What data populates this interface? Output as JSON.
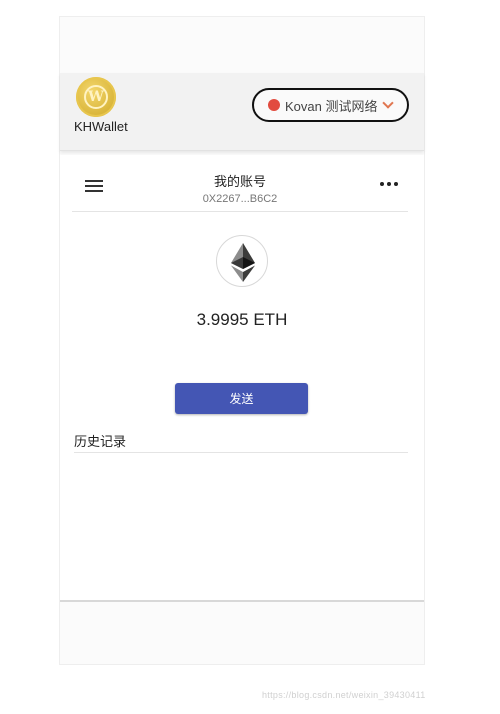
{
  "app": {
    "name": "KHWallet",
    "logo_icon": "wordpress-logo-icon"
  },
  "network": {
    "dot_color": "#e24c3f",
    "label": "Kovan 测试网络",
    "dropdown_icon": "chevron-down-icon"
  },
  "account": {
    "title": "我的账号",
    "address": "0X2267...B6C2",
    "menu_icon": "hamburger-menu-icon",
    "more_icon": "more-options-icon"
  },
  "wallet": {
    "token_icon": "ethereum-icon",
    "balance": "3.9995 ETH"
  },
  "actions": {
    "send_label": "发送",
    "accent_color": "#4456b4"
  },
  "history": {
    "title": "历史记录"
  },
  "watermark": "https://blog.csdn.net/weixin_39430411"
}
